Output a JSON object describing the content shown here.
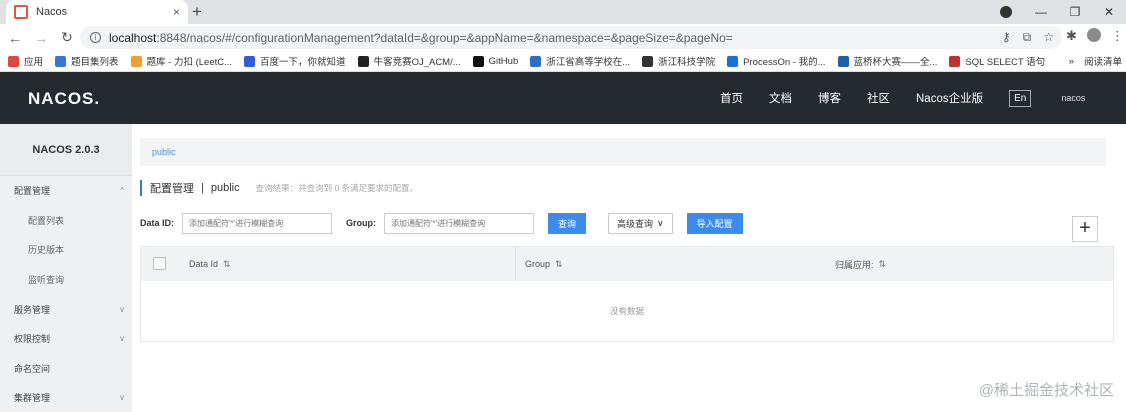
{
  "browser": {
    "tab_title": "Nacos",
    "tab_close": "×",
    "new_tab": "+",
    "url_host": "localhost",
    "url_rest": ":8848/nacos/#/configurationManagement?dataId=&group=&appName=&namespace=&pageSize=&pageNo=",
    "bookmarks": [
      {
        "label": "应用",
        "color": "#e0463b"
      },
      {
        "label": "题目集列表",
        "color": "#3a76d8"
      },
      {
        "label": "题库 - 力扣 (LeetC...",
        "color": "#f0a030"
      },
      {
        "label": "百度一下，你就知道",
        "color": "#2f5fd8"
      },
      {
        "label": "牛客竞赛OJ_ACM/...",
        "color": "#222222"
      },
      {
        "label": "GitHub",
        "color": "#111111"
      },
      {
        "label": "浙江省高等学校在...",
        "color": "#2a6fc7"
      },
      {
        "label": "浙江科技学院",
        "color": "#333333"
      },
      {
        "label": "ProcessOn - 我的...",
        "color": "#1a6fe0"
      },
      {
        "label": "蓝桥杯大赛——全...",
        "color": "#1d5fb0"
      },
      {
        "label": "SQL SELECT 语句",
        "color": "#c4302b"
      }
    ],
    "bookmarks_more": "»",
    "reading_list": "阅读清单"
  },
  "header": {
    "logo": "NACOS.",
    "nav": [
      "首页",
      "文档",
      "博客",
      "社区",
      "Nacos企业版"
    ],
    "lang": "En",
    "user": "nacos"
  },
  "sidebar": {
    "version": "NACOS 2.0.3",
    "items": [
      {
        "label": "配置管理",
        "sub": false,
        "chev": "^"
      },
      {
        "label": "配置列表",
        "sub": true,
        "chev": ""
      },
      {
        "label": "历史版本",
        "sub": true,
        "chev": ""
      },
      {
        "label": "监听查询",
        "sub": true,
        "chev": ""
      },
      {
        "label": "服务管理",
        "sub": false,
        "chev": "v"
      },
      {
        "label": "权限控制",
        "sub": false,
        "chev": "v"
      },
      {
        "label": "命名空间",
        "sub": false,
        "chev": ""
      },
      {
        "label": "集群管理",
        "sub": false,
        "chev": "v"
      }
    ]
  },
  "main": {
    "namespace_tab": "public",
    "title": "配置管理",
    "title_sep": "|",
    "namespace": "public",
    "result_text": "查询结果：共查询到 0 条满足要求的配置。",
    "filters": {
      "dataid_label": "Data ID:",
      "dataid_placeholder": "添加通配符'*'进行模糊查询",
      "group_label": "Group:",
      "group_placeholder": "添加通配符'*'进行模糊查询",
      "search": "查询",
      "advanced": "高级查询",
      "import": "导入配置",
      "add": "+"
    },
    "table": {
      "columns": [
        "Data Id",
        "Group",
        "归属应用:"
      ],
      "sort_icon": "⇅",
      "empty": "没有数据"
    }
  },
  "watermark": "@稀土掘金技术社区"
}
